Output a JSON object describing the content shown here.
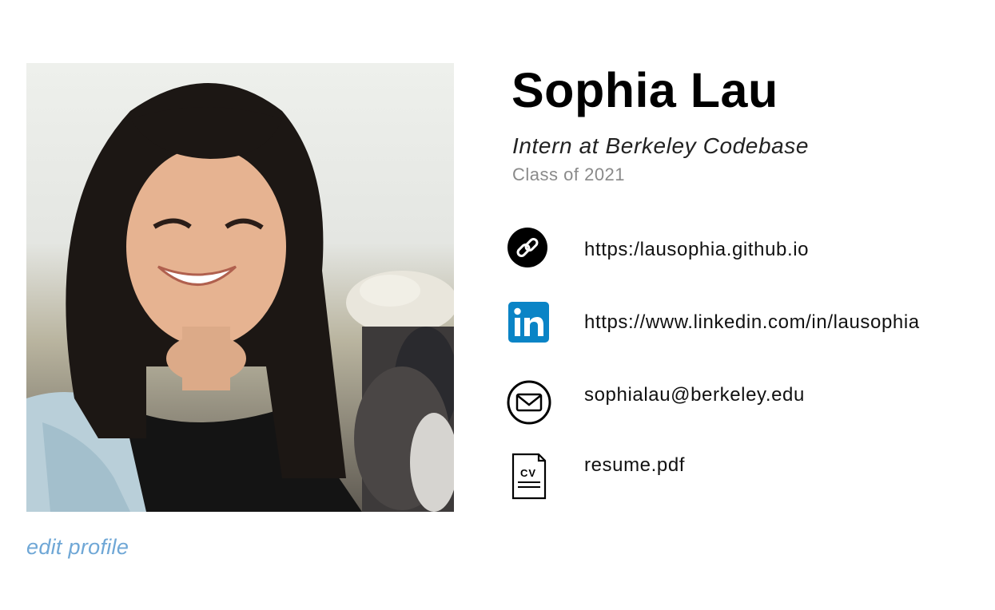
{
  "profile": {
    "name": "Sophia Lau",
    "role": "Intern at Berkeley Codebase",
    "class_year": "Class of 2021",
    "edit_label": "edit profile",
    "photo_alt": "Sophia Lau",
    "accent_color": "#6fa7d6"
  },
  "contacts": [
    {
      "icon": "link-icon",
      "text": "https:/lausophia.github.io"
    },
    {
      "icon": "linkedin-icon",
      "text": "https://www.linkedin.com/in/lausophia",
      "color": "#0a84c6"
    },
    {
      "icon": "mail-icon",
      "text": "sophialau@berkeley.edu"
    },
    {
      "icon": "cv-document-icon",
      "text": "resume.pdf",
      "badge": "CV"
    }
  ]
}
